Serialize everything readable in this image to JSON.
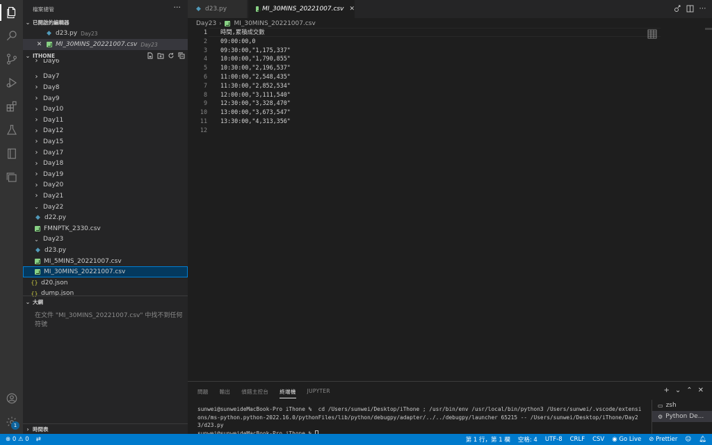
{
  "activity_bar": {
    "icons": [
      "explorer-icon",
      "search-icon",
      "source-control-icon",
      "run-debug-icon",
      "extensions-icon",
      "testing-icon",
      "notebook-icon",
      "remote-explorer-icon",
      "account-icon",
      "settings-gear-icon"
    ],
    "settings_badge": "1"
  },
  "sidebar": {
    "title": "檔案總管",
    "more": "···",
    "open_editors": {
      "header": "已開啟的編輯器",
      "items": [
        {
          "name": "d23.py",
          "hint": "Day23"
        },
        {
          "name": "MI_30MINS_20221007.csv",
          "hint": "Day23"
        }
      ]
    },
    "workspace": {
      "header": "ITHONE",
      "rows": [
        {
          "label": "Day6",
          "kind": "folder-closed"
        },
        {
          "label": "Day7",
          "kind": "folder-closed"
        },
        {
          "label": "Day8",
          "kind": "folder-closed"
        },
        {
          "label": "Day9",
          "kind": "folder-closed"
        },
        {
          "label": "Day10",
          "kind": "folder-closed"
        },
        {
          "label": "Day11",
          "kind": "folder-closed"
        },
        {
          "label": "Day12",
          "kind": "folder-closed"
        },
        {
          "label": "Day15",
          "kind": "folder-closed"
        },
        {
          "label": "Day17",
          "kind": "folder-closed"
        },
        {
          "label": "Day18",
          "kind": "folder-closed"
        },
        {
          "label": "Day19",
          "kind": "folder-closed"
        },
        {
          "label": "Day20",
          "kind": "folder-closed"
        },
        {
          "label": "Day21",
          "kind": "folder-closed"
        },
        {
          "label": "Day22",
          "kind": "folder-open"
        },
        {
          "label": "d22.py",
          "kind": "py"
        },
        {
          "label": "FMNPTK_2330.csv",
          "kind": "csv"
        },
        {
          "label": "Day23",
          "kind": "folder-open"
        },
        {
          "label": "d23.py",
          "kind": "py"
        },
        {
          "label": "MI_5MINS_20221007.csv",
          "kind": "csv"
        },
        {
          "label": "MI_30MINS_20221007.csv",
          "kind": "csv"
        },
        {
          "label": "d20.json",
          "kind": "json"
        },
        {
          "label": "dump.json",
          "kind": "json"
        }
      ]
    },
    "outline": {
      "header": "大綱",
      "message": "在文件 \"MI_30MINS_20221007.csv\" 中找不到任何符號"
    },
    "timeline": {
      "header": "時間表"
    }
  },
  "tabs": [
    {
      "label": "d23.py",
      "active": false
    },
    {
      "label": "MI_30MINS_20221007.csv",
      "active": true,
      "close": "✕"
    }
  ],
  "breadcrumb": {
    "folder": "Day23",
    "file": "MI_30MINS_20221007.csv"
  },
  "editor": {
    "lines": [
      "時間,累積成交數",
      "09:00:00,0",
      "09:30:00,\"1,175,337\"",
      "10:00:00,\"1,790,855\"",
      "10:30:00,\"2,196,537\"",
      "11:00:00,\"2,548,435\"",
      "11:30:00,\"2,852,534\"",
      "12:00:00,\"3,111,540\"",
      "12:30:00,\"3,328,470\"",
      "13:00:00,\"3,673,547\"",
      "13:30:00,\"4,313,356\"",
      ""
    ],
    "line_numbers": [
      "1",
      "2",
      "3",
      "4",
      "5",
      "6",
      "7",
      "8",
      "9",
      "10",
      "11",
      "12"
    ]
  },
  "panel": {
    "tabs": [
      "問題",
      "輸出",
      "偵錯主控台",
      "終端機",
      "JUPYTER"
    ],
    "active_tab": "終端機",
    "actions": [
      "+",
      "⌄",
      "⌃",
      "✕"
    ],
    "terminal_lines": [
      "sunwei@sunweideMacBook-Pro iThone %  cd /Users/sunwei/Desktop/iThone ; /usr/bin/env /usr/local/bin/python3 /Users/sunwei/.vscode/extensions/ms-python.python-2022.16.0/pythonFiles/lib/python/debugpy/adapter/../../debugpy/launcher 65215 -- /Users/sunwei/Desktop/iThone/Day23/d23.py",
      "sunwei@sunweideMacBook-Pro iThone % "
    ],
    "terminals": [
      "zsh",
      "Python De..."
    ]
  },
  "statusbar": {
    "errors": "0",
    "warnings": "0",
    "position": "第 1 行，第 1 欄",
    "spaces": "空格: 4",
    "encoding": "UTF-8",
    "eol": "CRLF",
    "language": "CSV",
    "go_live": "Go Live",
    "prettier": "Prettier"
  }
}
